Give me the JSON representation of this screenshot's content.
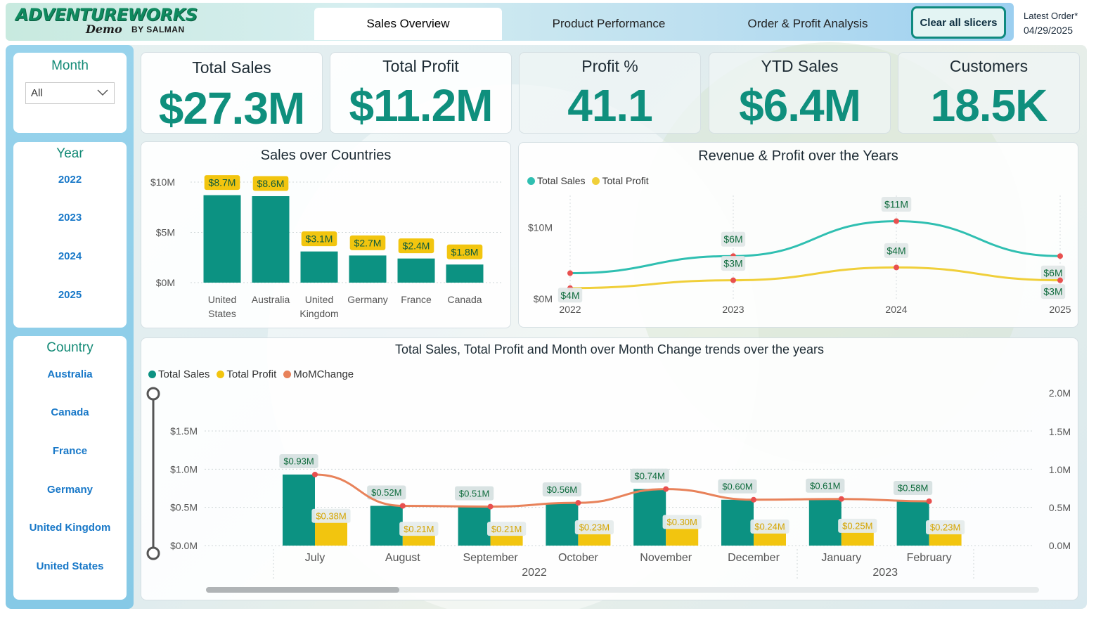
{
  "header": {
    "logo_line1": "ADVENTUREWORKS",
    "logo_line2": "Demo",
    "logo_line3": "BY SALMAN",
    "tabs": [
      {
        "label": "Sales Overview",
        "active": true
      },
      {
        "label": "Product Performance",
        "active": false
      },
      {
        "label": "Order & Profit Analysis",
        "active": false
      }
    ],
    "clear_button": "Clear all slicers",
    "latest_label": "Latest Order*",
    "latest_date": "04/29/2025"
  },
  "slicers": {
    "month": {
      "title": "Month",
      "selected": "All"
    },
    "year": {
      "title": "Year",
      "items": [
        "2022",
        "2023",
        "2024",
        "2025"
      ]
    },
    "country": {
      "title": "Country",
      "items": [
        "Australia",
        "Canada",
        "France",
        "Germany",
        "United Kingdom",
        "United States"
      ]
    }
  },
  "kpis": [
    {
      "title": "Total Sales",
      "value": "$27.3M"
    },
    {
      "title": "Total Profit",
      "value": "$11.2M"
    },
    {
      "title": "Profit %",
      "value": "41.1"
    },
    {
      "title": "YTD Sales",
      "value": "$6.4M"
    },
    {
      "title": "Customers",
      "value": "18.5K"
    }
  ],
  "colors": {
    "teal": "#0c9282",
    "yellow": "#f2c50f",
    "line_teal": "#2fbfb1",
    "line_yellow": "#f0cf3a",
    "orange": "#e8825a",
    "red_dot": "#e8504f",
    "label_green": "#0e6b3c"
  },
  "chart_data": [
    {
      "type": "bar",
      "title": "Sales over Countries",
      "categories": [
        "United States",
        "Australia",
        "United Kingdom",
        "Germany",
        "France",
        "Canada"
      ],
      "values": [
        8.7,
        8.6,
        3.1,
        2.7,
        2.4,
        1.8
      ],
      "labels": [
        "$8.7M",
        "$8.6M",
        "$3.1M",
        "$2.7M",
        "$2.4M",
        "$1.8M"
      ],
      "y_ticks": [
        "$10M",
        "$5M",
        "$0M"
      ],
      "ylim": [
        0,
        10
      ]
    },
    {
      "type": "line",
      "title": "Revenue & Profit over the Years",
      "x": [
        "2022",
        "2023",
        "2024",
        "2025"
      ],
      "y_ticks": [
        "$10M",
        "$0M"
      ],
      "ylim": [
        0,
        15
      ],
      "series": [
        {
          "name": "Total Sales",
          "values": [
            3.6,
            6,
            10.9,
            6
          ],
          "labels": [
            "",
            "$6M",
            "$11M",
            "$6M"
          ]
        },
        {
          "name": "Total Profit",
          "values": [
            1.5,
            2.6,
            4.4,
            2.6
          ],
          "labels": [
            "$4M",
            "$3M",
            "$4M",
            "$3M"
          ]
        }
      ]
    },
    {
      "type": "bar",
      "title": "Total Sales, Total Profit and Month over Month Change trends over the years",
      "categories": [
        "July",
        "August",
        "September",
        "October",
        "November",
        "December",
        "January",
        "February"
      ],
      "groups": [
        {
          "label": "2022",
          "count": 6
        },
        {
          "label": "2023",
          "count": 2
        }
      ],
      "y_left_ticks": [
        "$1.5M",
        "$1.0M",
        "$0.5M",
        "$0.0M"
      ],
      "y_right_ticks": [
        "2.0M",
        "1.5M",
        "1.0M",
        "0.5M",
        "0.0M"
      ],
      "ylim": [
        0,
        1.5
      ],
      "series": [
        {
          "name": "Total Sales",
          "values": [
            0.93,
            0.52,
            0.51,
            0.56,
            0.74,
            0.6,
            0.61,
            0.58
          ],
          "labels": [
            "$0.93M",
            "$0.52M",
            "$0.51M",
            "$0.56M",
            "$0.74M",
            "$0.60M",
            "$0.61M",
            "$0.58M"
          ]
        },
        {
          "name": "Total Profit",
          "values": [
            0.38,
            0.21,
            0.21,
            0.23,
            0.3,
            0.24,
            0.25,
            0.23
          ],
          "labels": [
            "$0.38M",
            "$0.21M",
            "$0.21M",
            "$0.23M",
            "$0.30M",
            "$0.24M",
            "$0.25M",
            "$0.23M"
          ]
        },
        {
          "name": "MoMChange",
          "type": "line",
          "values": [
            0.93,
            0.52,
            0.51,
            0.56,
            0.74,
            0.6,
            0.61,
            0.58
          ]
        }
      ]
    }
  ]
}
